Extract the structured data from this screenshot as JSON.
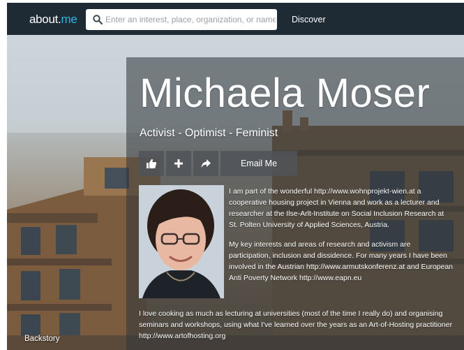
{
  "topbar": {
    "logo_left": "about.",
    "logo_right": "me",
    "search_placeholder": "Enter an interest, place, organization, or name",
    "discover_label": "Discover"
  },
  "profile": {
    "name": "Michaela Moser",
    "tagline": "Activist - Optimist - Feminist",
    "email_label": "Email Me",
    "bio_paragraphs": [
      "I am part of the wonderful http://www.wohnprojekt-wien.at a cooperative housing project in Vienna and work as a lecturer and researcher at the Ilse-Arlt-Institute on Social Inclusion Research at St. Polten University of Applied Sciences, Austria.",
      "My key interests and areas of research and activism are participation, inclusion and dissidence. For many years I have been involved in the Austrian http://www.armutskonferenz.at and European Anti Poverty Network http://www.eapn.eu"
    ],
    "bio_wide": "I love cooking as much as lecturing at universities (most of the time I really do) and organising seminars and workshops, using what I've learned over the years as an Art-of-Hosting practitioner http://www.artofhosting.org"
  },
  "footer": {
    "backstory_label": "Backstory"
  },
  "icons": {
    "like": "thumbs-up-icon",
    "add": "plus-icon",
    "share": "share-arrow-icon",
    "search": "search-icon"
  },
  "colors": {
    "topbar": "#1e2a34",
    "brand_accent": "#29b6e6"
  }
}
